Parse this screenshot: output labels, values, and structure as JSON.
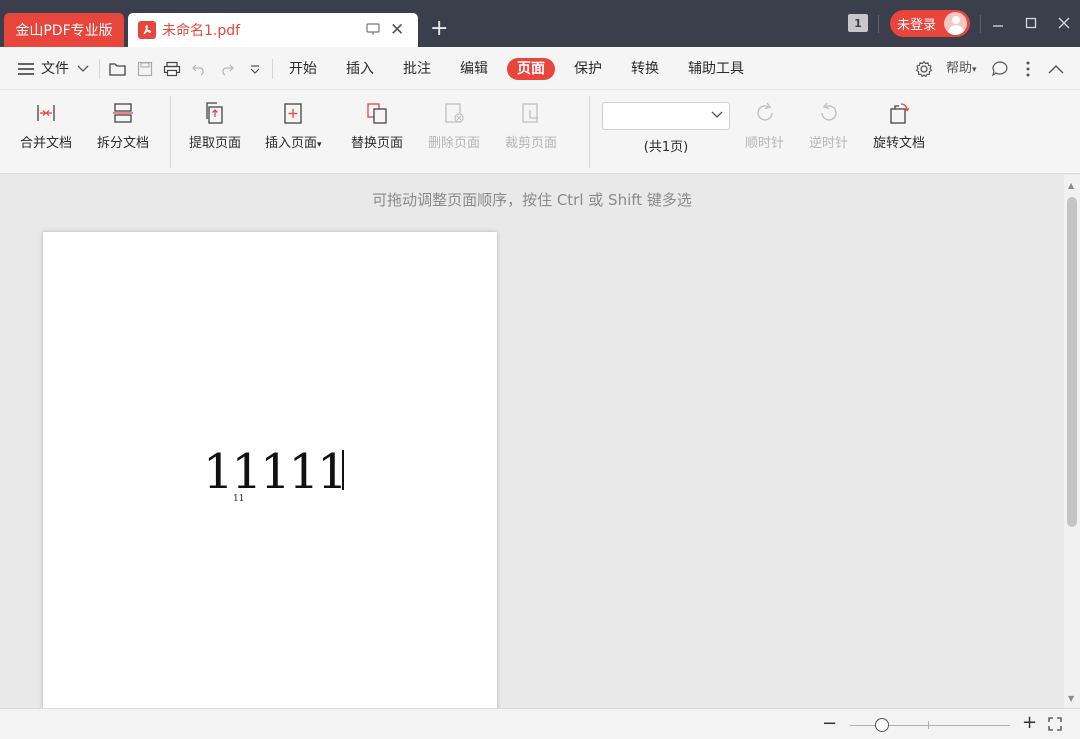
{
  "titlebar": {
    "brand": "金山PDF专业版",
    "doc_tab": {
      "icon": "pdf-file-icon",
      "title": "未命名1.pdf"
    },
    "new_tab": "+",
    "badge": "1",
    "login": "未登录",
    "window_controls": [
      "minimize-icon",
      "maximize-icon",
      "close-icon"
    ]
  },
  "menubar": {
    "file": "文件",
    "items": [
      "开始",
      "插入",
      "批注",
      "编辑",
      "页面",
      "保护",
      "转换",
      "辅助工具"
    ],
    "active": "页面",
    "help": "帮助"
  },
  "ribbon": {
    "merge": "合并文档",
    "split": "拆分文档",
    "extract": "提取页面",
    "insert": "插入页面",
    "replace": "替换页面",
    "delete": "删除页面",
    "crop": "裁剪页面",
    "page_select_value": "",
    "page_count": "(共1页)",
    "clockwise": "顺时针",
    "counterclockwise": "逆时针",
    "rotate_doc": "旋转文档"
  },
  "workspace": {
    "hint": "可拖动调整页面顺序，按住 Ctrl 或 Shift 键多选",
    "page_text_large": "11111",
    "page_text_small": "11"
  },
  "statusbar": {
    "zoom_out": "−",
    "zoom_in": "+",
    "zoom_fraction": 0.2
  },
  "colors": {
    "accent": "#e8453c",
    "titlebar": "#3b3f4c",
    "toolbar": "#f5f5f5",
    "workspace": "#e9e9e9"
  }
}
